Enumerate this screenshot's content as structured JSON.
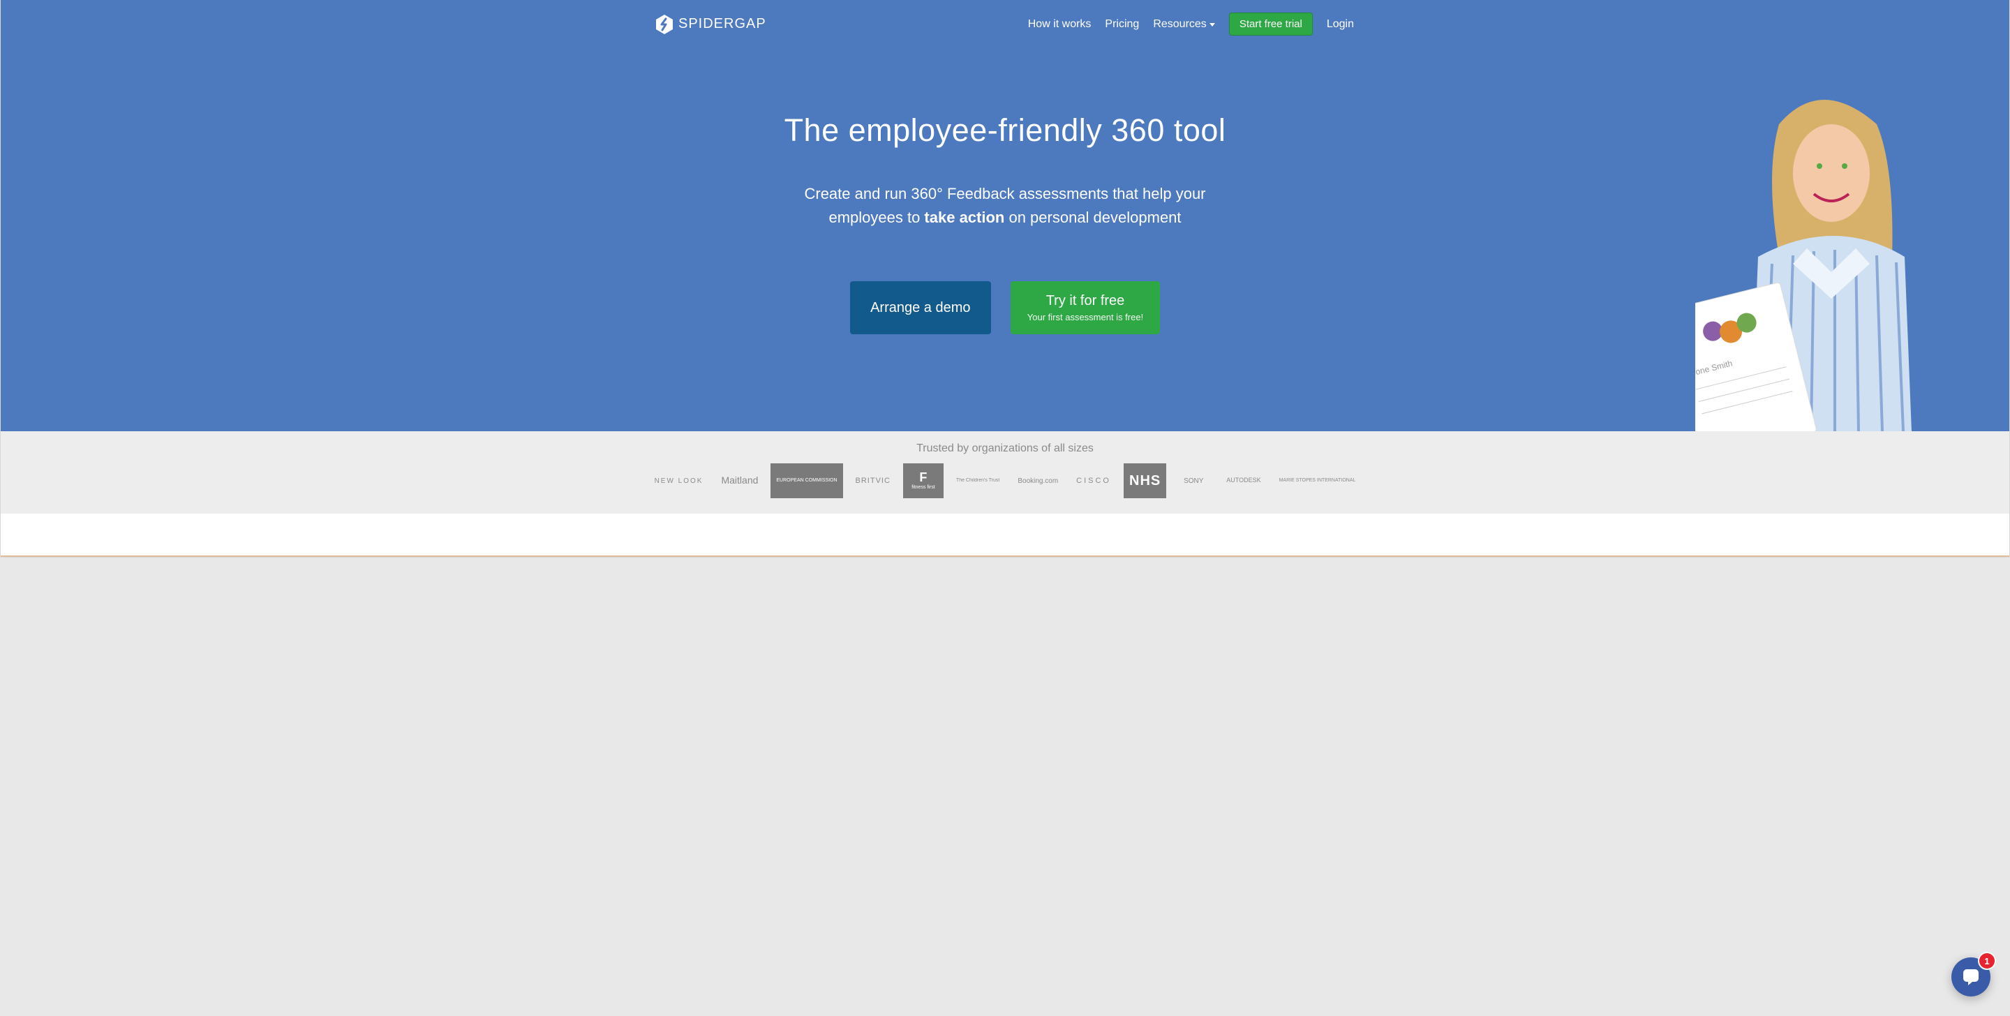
{
  "brand": {
    "name": "SPIDERGAP"
  },
  "nav": {
    "links": [
      {
        "label": "How it works"
      },
      {
        "label": "Pricing"
      },
      {
        "label": "Resources"
      }
    ],
    "cta": "Start free trial",
    "login": "Login"
  },
  "hero": {
    "title": "The employee-friendly 360 tool",
    "sub_pre": "Create and run 360° Feedback assessments that help your",
    "sub_line2_a": "employees to ",
    "sub_line2_strong": "take action",
    "sub_line2_b": " on personal development",
    "ctas": {
      "demo": "Arrange a demo",
      "try_main": "Try it for free",
      "try_sub": "Your first assessment is free!"
    }
  },
  "trusted": {
    "heading": "Trusted by organizations of all sizes",
    "logos": [
      "NEW LOOK",
      "Maitland",
      "EUROPEAN COMMISSION",
      "BRITVIC",
      "fitness first",
      "The Children's Trust",
      "Booking.com",
      "CISCO",
      "NHS",
      "SONY",
      "AUTODESK",
      "MARIE STOPES INTERNATIONAL"
    ]
  },
  "intercom": {
    "badge": "1"
  }
}
